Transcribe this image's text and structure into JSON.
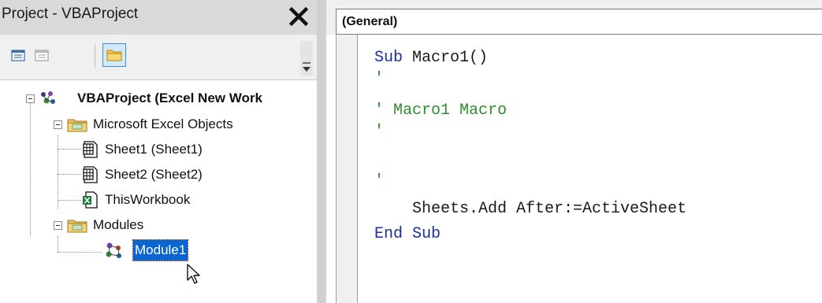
{
  "project_explorer": {
    "title": "Project - VBAProject",
    "close_glyph": "✕",
    "toolbar": {
      "view_code_icon": "view-code-icon",
      "view_object_icon": "view-object-icon",
      "toggle_folders_icon": "folder-icon"
    },
    "tree": {
      "root": {
        "label": "VBAProject (Excel New Work",
        "icon": "vba-project-icon",
        "expander": "−"
      },
      "excel_objects_folder": {
        "label": "Microsoft Excel Objects",
        "icon": "folder-icon",
        "expander": "−"
      },
      "sheet1": {
        "label": "Sheet1 (Sheet1)",
        "icon": "worksheet-icon"
      },
      "sheet2": {
        "label": "Sheet2 (Sheet2)",
        "icon": "worksheet-icon"
      },
      "thisworkbook": {
        "label": "ThisWorkbook",
        "icon": "workbook-icon"
      },
      "modules_folder": {
        "label": "Modules",
        "icon": "folder-icon",
        "expander": "−"
      },
      "module1": {
        "label": "Module1",
        "icon": "module-icon",
        "selected": true
      }
    }
  },
  "code_window": {
    "object_dropdown": {
      "value": "(General)"
    },
    "lines": {
      "l1_kw": "Sub",
      "l1_tx": " Macro1()",
      "l2": "'",
      "l3": "' Macro1 Macro",
      "l4": "'",
      "l5": "'",
      "l6": "    Sheets.Add After:=ActiveSheet",
      "l7_kw": "End Sub"
    }
  },
  "colors": {
    "keyword": "#1b2d9c",
    "comment": "#2e8b2e",
    "selection": "#0a64d2"
  }
}
